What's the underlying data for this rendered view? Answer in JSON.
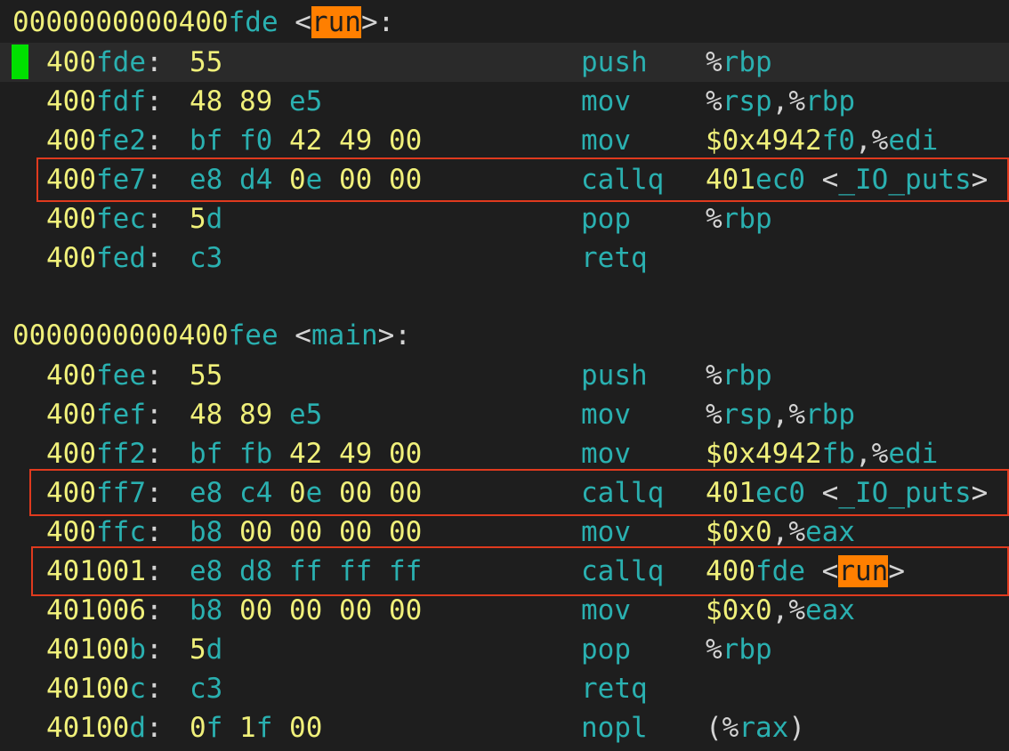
{
  "theme": {
    "digit_color": "#f0f07a",
    "letter_color": "#2ab0b0",
    "punct_color": "#d4d4d4",
    "highlight_color": "#ff7f00",
    "box_color": "#e03a1e",
    "cursor_color": "#00e000"
  },
  "functions": [
    {
      "header": {
        "addr_num": "0000000000400",
        "addr_hex": "fde",
        "open": " <",
        "name": "run",
        "close": ">:"
      },
      "rows": [
        {
          "a1": "400",
          "a2": "fde",
          "b": [
            [
              "55",
              "y"
            ]
          ],
          "mn": "push",
          "op": [
            [
              "%",
              "w"
            ],
            [
              "rbp",
              "c"
            ]
          ]
        },
        {
          "a1": "400",
          "a2": "fdf",
          "b": [
            [
              "48",
              "y"
            ],
            [
              "89",
              "y"
            ],
            [
              "e5",
              "c"
            ]
          ],
          "mn": "mov",
          "op": [
            [
              "%",
              "w"
            ],
            [
              "rsp",
              "c"
            ],
            [
              ",%",
              "w"
            ],
            [
              "rbp",
              "c"
            ]
          ]
        },
        {
          "a1": "400",
          "a2": "fe2",
          "b": [
            [
              "bf",
              "c"
            ],
            [
              "f0",
              "c"
            ],
            [
              "42",
              "y"
            ],
            [
              "49",
              "y"
            ],
            [
              "00",
              "y"
            ]
          ],
          "mn": "mov",
          "op": [
            [
              "$0x4942",
              "y"
            ],
            [
              "f0",
              "c"
            ],
            [
              ",%",
              "w"
            ],
            [
              "edi",
              "c"
            ]
          ]
        },
        {
          "a1": "400",
          "a2": "fe7",
          "b": [
            [
              "e8",
              "c"
            ],
            [
              "d4",
              "c"
            ],
            [
              "0e",
              "m"
            ],
            [
              "00",
              "y"
            ],
            [
              "00",
              "y"
            ]
          ],
          "mn": "callq",
          "op": [
            [
              "401",
              "y"
            ],
            [
              "ec0",
              "c"
            ],
            [
              " <",
              "w"
            ],
            [
              "_IO_puts",
              "c"
            ],
            [
              ">",
              "w"
            ]
          ]
        },
        {
          "a1": "400",
          "a2": "fec",
          "b": [
            [
              "5d",
              "m"
            ]
          ],
          "mn": "pop",
          "op": [
            [
              "%",
              "w"
            ],
            [
              "rbp",
              "c"
            ]
          ]
        },
        {
          "a1": "400",
          "a2": "fed",
          "b": [
            [
              "c3",
              "c"
            ]
          ],
          "mn": "retq",
          "op": []
        }
      ]
    },
    {
      "header": {
        "addr_num": "0000000000400",
        "addr_hex": "fee",
        "open": " <",
        "name": "main",
        "close": ">:"
      },
      "rows": [
        {
          "a1": "400",
          "a2": "fee",
          "b": [
            [
              "55",
              "y"
            ]
          ],
          "mn": "push",
          "op": [
            [
              "%",
              "w"
            ],
            [
              "rbp",
              "c"
            ]
          ]
        },
        {
          "a1": "400",
          "a2": "fef",
          "b": [
            [
              "48",
              "y"
            ],
            [
              "89",
              "y"
            ],
            [
              "e5",
              "c"
            ]
          ],
          "mn": "mov",
          "op": [
            [
              "%",
              "w"
            ],
            [
              "rsp",
              "c"
            ],
            [
              ",%",
              "w"
            ],
            [
              "rbp",
              "c"
            ]
          ]
        },
        {
          "a1": "400",
          "a2": "ff2",
          "b": [
            [
              "bf",
              "c"
            ],
            [
              "fb",
              "c"
            ],
            [
              "42",
              "y"
            ],
            [
              "49",
              "y"
            ],
            [
              "00",
              "y"
            ]
          ],
          "mn": "mov",
          "op": [
            [
              "$0x4942",
              "y"
            ],
            [
              "fb",
              "c"
            ],
            [
              ",%",
              "w"
            ],
            [
              "edi",
              "c"
            ]
          ]
        },
        {
          "a1": "400",
          "a2": "ff7",
          "b": [
            [
              "e8",
              "c"
            ],
            [
              "c4",
              "c"
            ],
            [
              "0e",
              "m"
            ],
            [
              "00",
              "y"
            ],
            [
              "00",
              "y"
            ]
          ],
          "mn": "callq",
          "op": [
            [
              "401",
              "y"
            ],
            [
              "ec0",
              "c"
            ],
            [
              " <",
              "w"
            ],
            [
              "_IO_puts",
              "c"
            ],
            [
              ">",
              "w"
            ]
          ]
        },
        {
          "a1": "400",
          "a2": "ffc",
          "b": [
            [
              "b8",
              "c"
            ],
            [
              "00",
              "y"
            ],
            [
              "00",
              "y"
            ],
            [
              "00",
              "y"
            ],
            [
              "00",
              "y"
            ]
          ],
          "mn": "mov",
          "op": [
            [
              "$0x0",
              "y"
            ],
            [
              ",%",
              "w"
            ],
            [
              "eax",
              "c"
            ]
          ]
        },
        {
          "a1": "401001",
          "a2": "",
          "b": [
            [
              "e8",
              "c"
            ],
            [
              "d8",
              "c"
            ],
            [
              "ff",
              "c"
            ],
            [
              "ff",
              "c"
            ],
            [
              "ff",
              "c"
            ]
          ],
          "mn": "callq",
          "op": [
            [
              "400",
              "y"
            ],
            [
              "fde",
              "c"
            ],
            [
              " <",
              "w"
            ],
            [
              "run",
              "h"
            ],
            [
              ">",
              "w"
            ]
          ]
        },
        {
          "a1": "401006",
          "a2": "",
          "b": [
            [
              "b8",
              "c"
            ],
            [
              "00",
              "y"
            ],
            [
              "00",
              "y"
            ],
            [
              "00",
              "y"
            ],
            [
              "00",
              "y"
            ]
          ],
          "mn": "mov",
          "op": [
            [
              "$0x0",
              "y"
            ],
            [
              ",%",
              "w"
            ],
            [
              "eax",
              "c"
            ]
          ]
        },
        {
          "a1": "40100",
          "a2": "b",
          "b": [
            [
              "5d",
              "m"
            ]
          ],
          "mn": "pop",
          "op": [
            [
              "%",
              "w"
            ],
            [
              "rbp",
              "c"
            ]
          ]
        },
        {
          "a1": "40100",
          "a2": "c",
          "b": [
            [
              "c3",
              "c"
            ]
          ],
          "mn": "retq",
          "op": []
        },
        {
          "a1": "40100",
          "a2": "d",
          "b": [
            [
              "0f",
              "m"
            ],
            [
              "1f",
              "m"
            ],
            [
              "00",
              "y"
            ]
          ],
          "mn": "nopl",
          "op": [
            [
              "(%",
              "w"
            ],
            [
              "rax",
              "c"
            ],
            [
              ")",
              "w"
            ]
          ]
        }
      ]
    }
  ]
}
